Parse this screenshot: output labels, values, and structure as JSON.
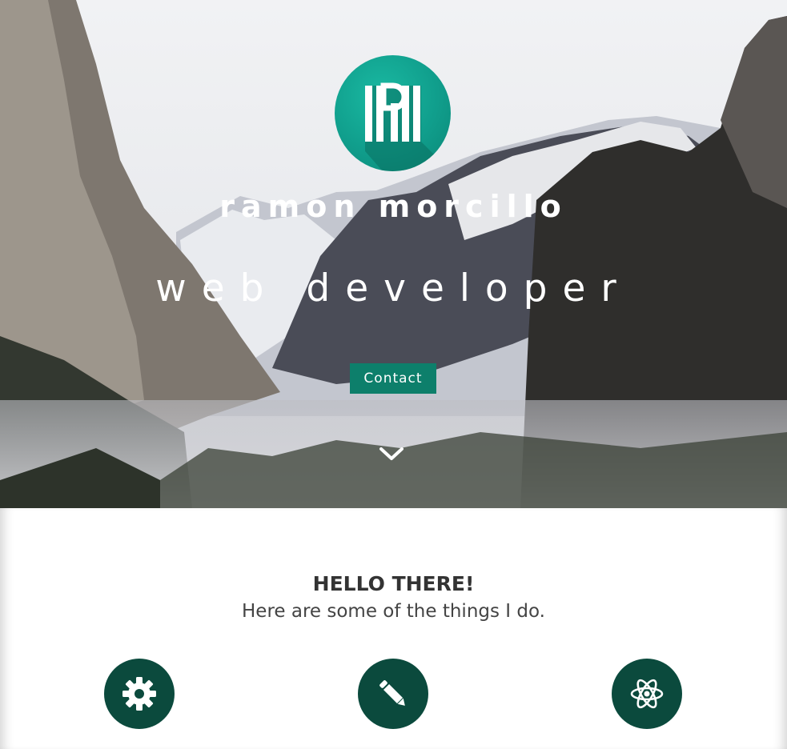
{
  "hero": {
    "name": "ramon morcillo",
    "role": "web developer",
    "contact_label": "Contact"
  },
  "intro": {
    "heading": "HELLO THERE!",
    "subheading": "Here are some of the things I do."
  },
  "services": [
    {
      "icon": "gear-icon"
    },
    {
      "icon": "pencil-icon"
    },
    {
      "icon": "atom-icon"
    }
  ],
  "colors": {
    "accent": "#0d7f6b",
    "service_circle": "#0b4a3d",
    "logo": "#109e8c"
  }
}
